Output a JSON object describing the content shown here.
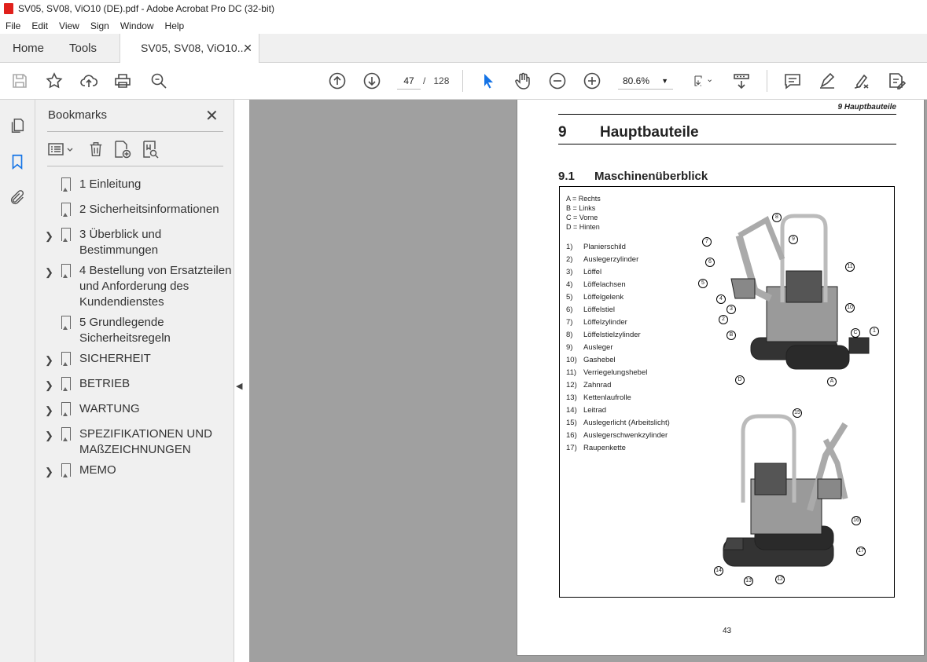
{
  "window": {
    "title": "SV05, SV08, ViO10 (DE).pdf - Adobe Acrobat Pro DC (32-bit)"
  },
  "menu": [
    "File",
    "Edit",
    "View",
    "Sign",
    "Window",
    "Help"
  ],
  "tabs": {
    "home": "Home",
    "tools": "Tools",
    "doc": "SV05, SV08, ViO10..."
  },
  "toolbar": {
    "page_current": "47",
    "page_sep": "/",
    "page_total": "128",
    "zoom": "80.6%"
  },
  "bookmarks": {
    "title": "Bookmarks",
    "items": [
      {
        "label": "1 Einleitung",
        "expandable": false
      },
      {
        "label": "2 Sicherheitsinformationen",
        "expandable": false
      },
      {
        "label": "3 Überblick und Bestimmungen",
        "expandable": true
      },
      {
        "label": "4 Bestellung von Ersatzteilen und Anforderung des Kundendienstes",
        "expandable": true
      },
      {
        "label": "5 Grundlegende Sicherheitsregeln",
        "expandable": false
      },
      {
        "label": "SICHERHEIT",
        "expandable": true
      },
      {
        "label": "BETRIEB",
        "expandable": true
      },
      {
        "label": "WARTUNG",
        "expandable": true
      },
      {
        "label": "SPEZIFIKATIONEN UND MAßZEICHNUNGEN",
        "expandable": true
      },
      {
        "label": "MEMO",
        "expandable": true
      }
    ]
  },
  "document": {
    "running_head": "9 Hauptbauteile",
    "chapter_num": "9",
    "chapter_title": "Hauptbauteile",
    "section_num": "9.1",
    "section_title": "Maschinenüberblick",
    "legend": [
      "A = Rechts",
      "B = Links",
      "C = Vorne",
      "D = Hinten"
    ],
    "parts": [
      {
        "n": "1)",
        "t": "Planierschild"
      },
      {
        "n": "2)",
        "t": "Auslegerzylinder"
      },
      {
        "n": "3)",
        "t": "Löffel"
      },
      {
        "n": "4)",
        "t": "Löffelachsen"
      },
      {
        "n": "5)",
        "t": "Löffelgelenk"
      },
      {
        "n": "6)",
        "t": "Löffelstiel"
      },
      {
        "n": "7)",
        "t": "Löffelzylinder"
      },
      {
        "n": "8)",
        "t": "Löffelstielzylinder"
      },
      {
        "n": "9)",
        "t": "Ausleger"
      },
      {
        "n": "10)",
        "t": "Gashebel"
      },
      {
        "n": "11)",
        "t": "Verriegelungshebel"
      },
      {
        "n": "12)",
        "t": "Zahnrad"
      },
      {
        "n": "13)",
        "t": "Kettenlaufrolle"
      },
      {
        "n": "14)",
        "t": "Leitrad"
      },
      {
        "n": "15)",
        "t": "Auslegerlicht (Arbeitslicht)"
      },
      {
        "n": "16)",
        "t": "Auslegerschwenkzylinder"
      },
      {
        "n": "17)",
        "t": "Raupenkette"
      }
    ],
    "callouts_top": [
      "8",
      "7",
      "9",
      "6",
      "11",
      "5",
      "4",
      "3",
      "10",
      "2",
      "B",
      "C",
      "1",
      "D",
      "A"
    ],
    "callouts_bottom": [
      "15",
      "16",
      "17",
      "14",
      "13",
      "12"
    ],
    "page_number": "43"
  }
}
